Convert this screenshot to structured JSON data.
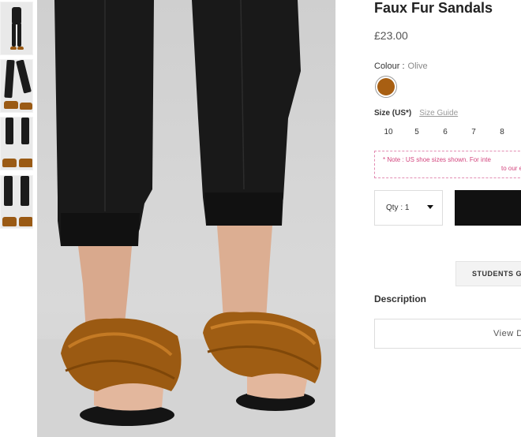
{
  "product": {
    "title": "Faux Fur Sandals",
    "price": "£23.00"
  },
  "colour": {
    "label": "Colour :",
    "value": "Olive",
    "swatch_hex": "#a85f12"
  },
  "size": {
    "label": "Size (US*)",
    "guide_link": "Size Guide",
    "options": [
      "10",
      "5",
      "6",
      "7",
      "8"
    ]
  },
  "note": {
    "line1": "* Note : US shoe sizes shown. For inte",
    "line2": "to our e"
  },
  "quantity": {
    "label": "Qty : 1"
  },
  "students_button": "STUDENTS G",
  "description": {
    "title": "Description",
    "view_button": "View D"
  },
  "colors": {
    "accent_black": "#111111",
    "note_pink": "#d3457e",
    "fur": "#a85f12"
  },
  "icons": [
    "chevron-down-icon"
  ],
  "thumbnails": [
    "thumbnail-1",
    "thumbnail-2",
    "thumbnail-3",
    "thumbnail-4"
  ]
}
